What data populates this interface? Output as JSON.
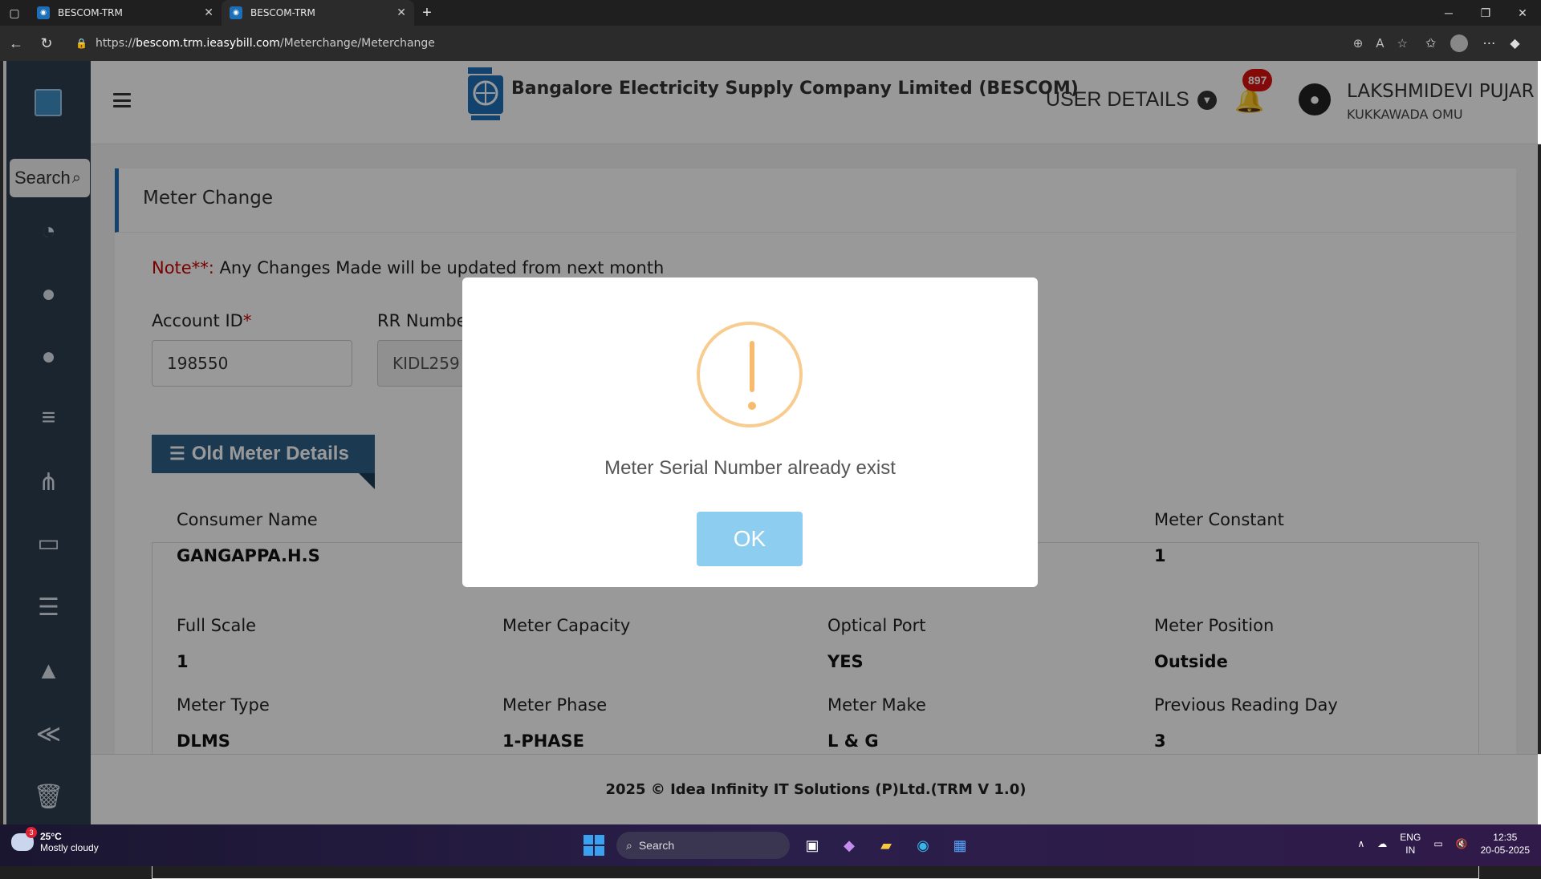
{
  "browser": {
    "tabs": [
      {
        "title": "BESCOM-TRM",
        "active": false
      },
      {
        "title": "BESCOM-TRM",
        "active": true
      }
    ],
    "url_prefix": "https://",
    "url_host": "bescom.trm.ieasybill.com",
    "url_path": "/Meterchange/Meterchange"
  },
  "sidebar": {
    "search_label": "Search",
    "icons": [
      "dashboard-icon",
      "user-icon",
      "user-icon",
      "list-icon",
      "sitemap-icon",
      "desktop-icon",
      "ordered-list-icon",
      "road-icon",
      "vk-icon",
      "trash-icon"
    ]
  },
  "header": {
    "company_name": "Bangalore Electricity Supply Company Limited (BESCOM)",
    "user_details_label": "USER DETAILS",
    "notification_count": "897",
    "user_name": "LAKSHMIDEVI PUJAR",
    "user_location": "KUKKAWADA OMU"
  },
  "page": {
    "title": "Meter Change",
    "note_key": "Note**:",
    "note_text": " Any Changes Made will be updated from next month",
    "account_id_label": "Account ID",
    "account_id_required": "*",
    "account_id_value": "198550",
    "rr_number_label": "RR Number",
    "rr_number_value": "KIDL259",
    "section_title": "Old Meter Details",
    "details": [
      {
        "label": "Consumer Name",
        "value": "GANGAPPA.H.S"
      },
      {
        "label": "Meter Constant",
        "value": "1"
      },
      {
        "label": "Full Scale",
        "value": "1"
      },
      {
        "label": "Meter Capacity",
        "value": ""
      },
      {
        "label": "Optical Port",
        "value": "YES"
      },
      {
        "label": "Meter Position",
        "value": "Outside"
      },
      {
        "label": "Meter Type",
        "value": "DLMS"
      },
      {
        "label": "Meter Phase",
        "value": "1-PHASE"
      },
      {
        "label": "Meter Make",
        "value": "L & G"
      },
      {
        "label": "Previous Reading Day",
        "value": "3"
      }
    ]
  },
  "footer": {
    "text": "2025 © Idea Infinity IT Solutions (P)Ltd.(TRM V 1.0)"
  },
  "modal": {
    "message": "Meter Serial Number already exist",
    "ok_label": "OK",
    "icon": "warning-icon",
    "icon_color": "#f8bb6b",
    "button_color": "#8dcdf0"
  },
  "taskbar": {
    "weather_temp": "25°C",
    "weather_desc": "Mostly cloudy",
    "weather_badge": "3",
    "search_placeholder": "Search",
    "lang_line1": "ENG",
    "lang_line2": "IN",
    "time": "12:35",
    "date": "20-05-2025"
  }
}
